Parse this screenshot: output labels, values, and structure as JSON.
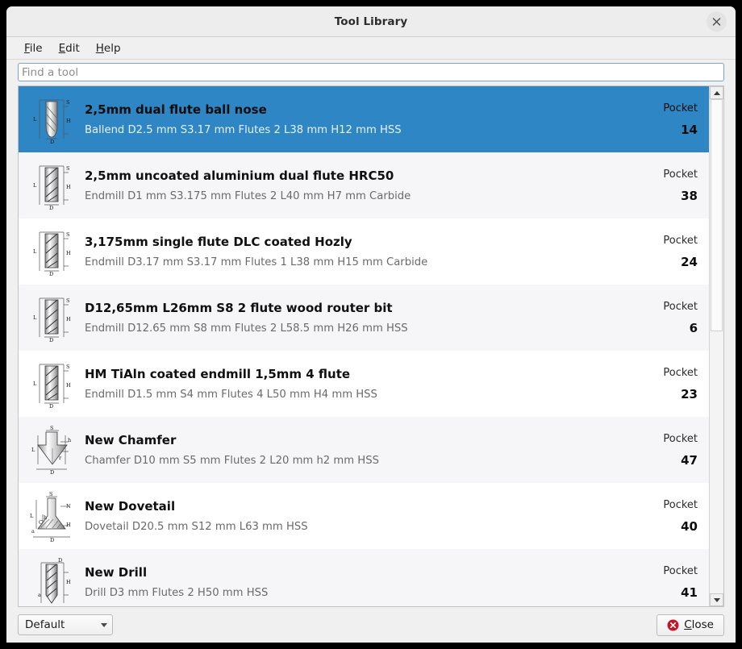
{
  "window": {
    "title": "Tool Library",
    "close_icon": "close-icon"
  },
  "menubar": {
    "items": [
      {
        "label": "File",
        "mnemonic": "F",
        "rest": "ile"
      },
      {
        "label": "Edit",
        "mnemonic": "E",
        "rest": "dit"
      },
      {
        "label": "Help",
        "mnemonic": "H",
        "rest": "elp"
      }
    ]
  },
  "search": {
    "placeholder": "Find a tool",
    "value": ""
  },
  "list": {
    "pocket_label": "Pocket",
    "items": [
      {
        "name": "2,5mm dual flute ball nose",
        "details": "Ballend D2.5 mm S3.17 mm Flutes 2 L38 mm H12 mm HSS",
        "pocket": "14",
        "icon": "ballend-tool-icon",
        "selected": true
      },
      {
        "name": "2,5mm uncoated aluminium dual flute HRC50",
        "details": "Endmill D1 mm S3.175 mm Flutes 2 L40 mm H7 mm Carbide",
        "pocket": "38",
        "icon": "endmill-tool-icon",
        "selected": false
      },
      {
        "name": "3,175mm single flute DLC coated Hozly",
        "details": "Endmill D3.17 mm S3.17 mm Flutes 1 L38 mm H15 mm Carbide",
        "pocket": "24",
        "icon": "endmill-tool-icon",
        "selected": false
      },
      {
        "name": "D12,65mm L26mm S8 2 flute wood router bit",
        "details": "Endmill D12.65 mm S8 mm Flutes 2 L58.5 mm H26 mm HSS",
        "pocket": "6",
        "icon": "endmill-tool-icon",
        "selected": false
      },
      {
        "name": "HM TiAln coated endmill 1,5mm 4 flute",
        "details": "Endmill D1.5 mm S4 mm Flutes 4 L50 mm H4 mm HSS",
        "pocket": "23",
        "icon": "endmill-tool-icon",
        "selected": false
      },
      {
        "name": "New Chamfer",
        "details": "Chamfer D10 mm S5 mm Flutes 2 L20 mm h2 mm HSS",
        "pocket": "47",
        "icon": "chamfer-tool-icon",
        "selected": false
      },
      {
        "name": "New Dovetail",
        "details": "Dovetail D20.5 mm S12 mm L63 mm HSS",
        "pocket": "40",
        "icon": "dovetail-tool-icon",
        "selected": false
      },
      {
        "name": "New Drill",
        "details": "Drill D3 mm Flutes 2 H50 mm HSS",
        "pocket": "41",
        "icon": "drill-tool-icon",
        "selected": false
      }
    ]
  },
  "scrollbar": {
    "up_icon": "scroll-up-arrow-icon",
    "down_icon": "scroll-down-arrow-icon"
  },
  "bottom": {
    "combo_value": "Default",
    "close_mnemonic": "C",
    "close_rest": "lose",
    "close_icon": "cancel-icon"
  },
  "colors": {
    "selection": "#2e86c5",
    "alt_row": "#f6f6f8",
    "row": "#ffffff",
    "chrome": "#f0f0f0",
    "close_icon_red": "#c0182b"
  }
}
